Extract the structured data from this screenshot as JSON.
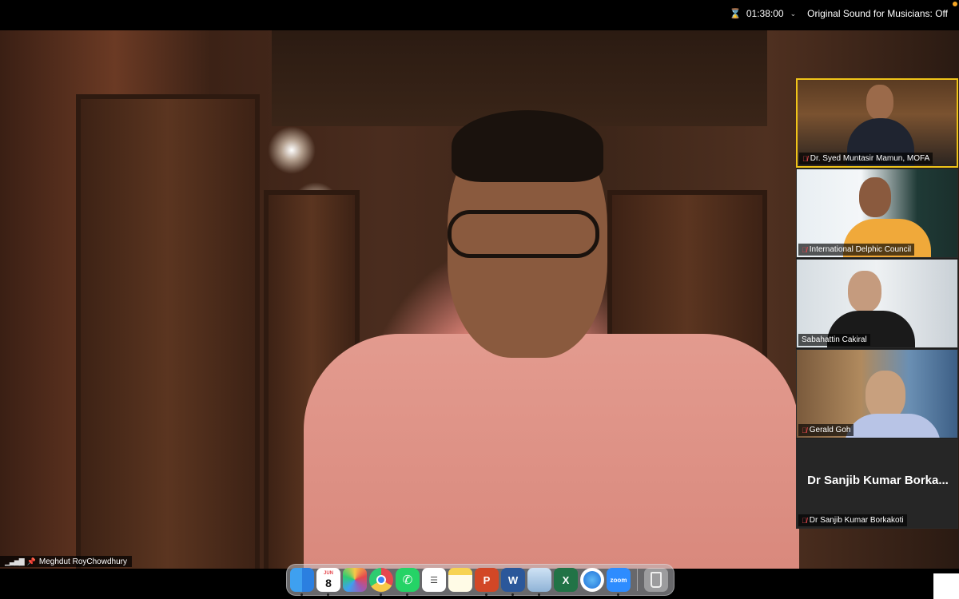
{
  "top_bar": {
    "timer": "01:38:00",
    "original_sound": "Original Sound for Musicians: Off"
  },
  "main_speaker": {
    "name": "Meghdut RoyChowdhury"
  },
  "participants": [
    {
      "name": "Dr. Syed Muntasir Mamun, MOFA",
      "muted": true,
      "active": true
    },
    {
      "name": "International Delphic Council",
      "muted": true
    },
    {
      "name": "Sabahattin Cakiral",
      "muted": false
    },
    {
      "name": "Gerald Goh",
      "muted": true
    },
    {
      "name": "Dr Sanjib Kumar Borkakoti",
      "display_title": "Dr Sanjib Kumar Borka...",
      "muted": true,
      "video_off": true
    }
  ],
  "dock": {
    "apps": [
      "finder-icon",
      "calendar-icon",
      "photos-icon",
      "chrome-icon",
      "whatsapp-icon",
      "reminders-icon",
      "notes-icon",
      "powerpoint-icon",
      "word-icon",
      "preview-icon",
      "excel-icon",
      "safari-icon",
      "zoom-icon",
      "trash-icon"
    ],
    "calendar_month": "JUN",
    "calendar_day": "8",
    "zoom_label": "zoom",
    "powerpoint_letter": "P",
    "word_letter": "W",
    "excel_letter": "X"
  },
  "colors": {
    "active_speaker_border": "#f0c419",
    "muted_icon": "#e5484d",
    "recording_dot": "#f5a623"
  }
}
